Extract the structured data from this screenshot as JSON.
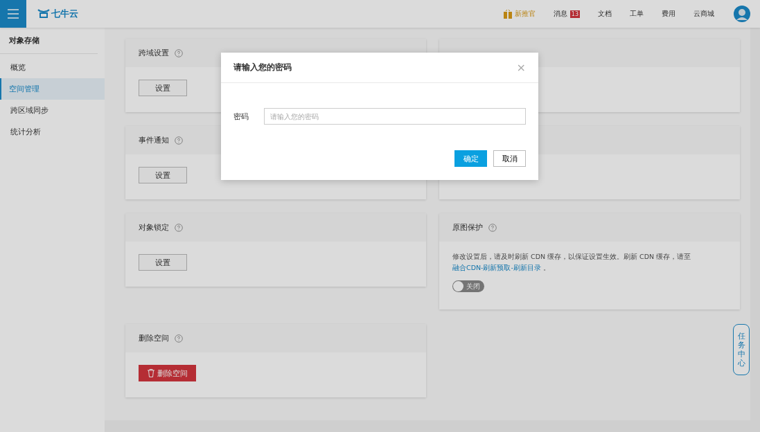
{
  "header": {
    "logo": "七牛云",
    "nav": [
      {
        "label": "新推官",
        "kind": "promo"
      },
      {
        "label": "消息",
        "kind": "badge",
        "badge": "13"
      },
      {
        "label": "文档",
        "kind": "plain"
      },
      {
        "label": "工单",
        "kind": "plain"
      },
      {
        "label": "费用",
        "kind": "plain"
      },
      {
        "label": "云商城",
        "kind": "plain"
      }
    ]
  },
  "sidebar": {
    "title": "对象存储",
    "items": [
      {
        "label": "概览",
        "selected": false
      },
      {
        "label": "空间管理",
        "selected": true
      },
      {
        "label": "跨区域同步",
        "selected": false
      },
      {
        "label": "统计分析",
        "selected": false
      }
    ]
  },
  "left_cards": [
    {
      "title": "跨域设置",
      "kind": "button",
      "button": "设置"
    },
    {
      "title": "事件通知",
      "kind": "button",
      "button": "设置"
    },
    {
      "title": "对象锁定",
      "kind": "button",
      "button": "设置"
    },
    {
      "title": "删除空间",
      "kind": "danger",
      "button": "删除空间"
    }
  ],
  "right_card": {
    "title": "原图保护",
    "text": "修改设置后，请及时刷新 CDN 缓存，以保证设置生效。刷新 CDN 缓存，请至 ",
    "link": "融合CDN-刷新预取-刷新目录",
    "suffix": " 。",
    "toggle": {
      "on": false,
      "label": "关闭"
    }
  },
  "task_center": "任务中心",
  "dialog": {
    "title": "请输入您的密码",
    "close": "×",
    "field_label": "密码",
    "placeholder": "请输入您的密码",
    "buttons": [
      {
        "label": "确定",
        "kind": "primary"
      },
      {
        "label": "取消",
        "kind": "default"
      }
    ]
  }
}
